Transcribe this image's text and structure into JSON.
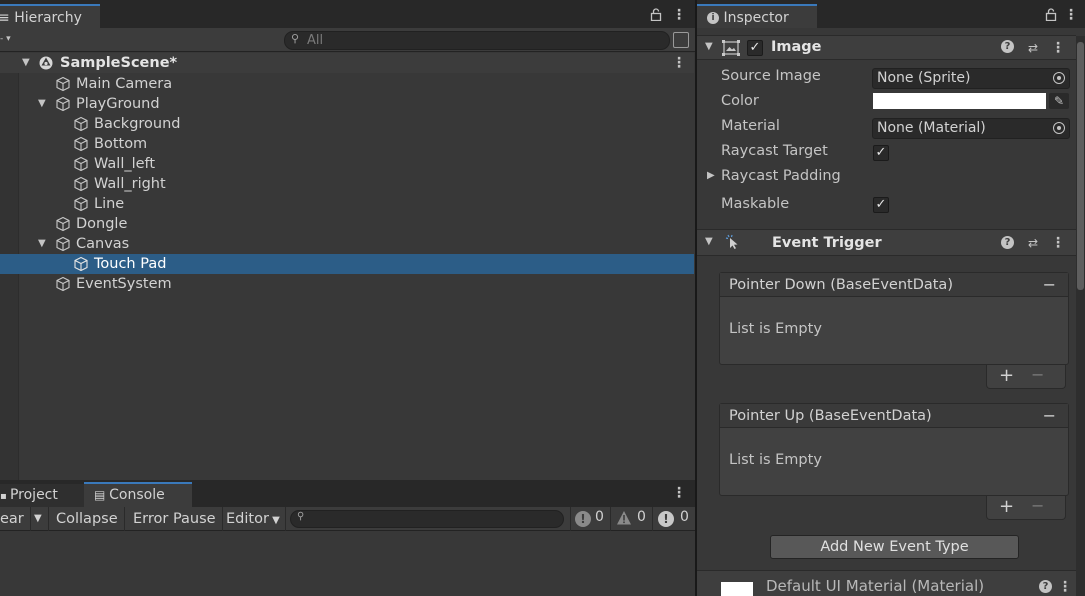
{
  "hierarchy": {
    "tab_label": "Hierarchy",
    "search_placeholder": "All",
    "scene_name": "SampleScene*",
    "items": [
      {
        "label": "Main Camera"
      },
      {
        "label": "PlayGround"
      },
      {
        "label": "Background"
      },
      {
        "label": "Bottom"
      },
      {
        "label": "Wall_left"
      },
      {
        "label": "Wall_right"
      },
      {
        "label": "Line"
      },
      {
        "label": "Dongle"
      },
      {
        "label": "Canvas"
      },
      {
        "label": "Touch Pad"
      },
      {
        "label": "EventSystem"
      }
    ]
  },
  "bottom": {
    "tabs": [
      {
        "label": "Project"
      },
      {
        "label": "Console"
      }
    ],
    "toolbar": {
      "clear_label": "ear",
      "collapse_label": "Collapse",
      "error_pause_label": "Error Pause",
      "editor_label": "Editor",
      "info_count": "0",
      "warning_count": "0",
      "error_count": "0"
    }
  },
  "inspector": {
    "tab_label": "Inspector",
    "image_component": {
      "title": "Image",
      "enabled": true,
      "source_image_label": "Source Image",
      "source_image_value": "None (Sprite)",
      "color_label": "Color",
      "color_value": "#ffffff",
      "material_label": "Material",
      "material_value": "None (Material)",
      "raycast_target_label": "Raycast Target",
      "raycast_target": true,
      "raycast_padding_label": "Raycast Padding",
      "maskable_label": "Maskable",
      "maskable": true
    },
    "event_trigger": {
      "title": "Event Trigger",
      "events": [
        {
          "header": "Pointer Down (BaseEventData)",
          "body": "List is Empty"
        },
        {
          "header": "Pointer Up (BaseEventData)",
          "body": "List is Empty"
        }
      ],
      "add_button": "Add New Event Type"
    },
    "material_footer": "Default UI Material (Material)"
  },
  "colors": {
    "selection": "#2c5d87",
    "tab_accent": "#3a79bb"
  }
}
